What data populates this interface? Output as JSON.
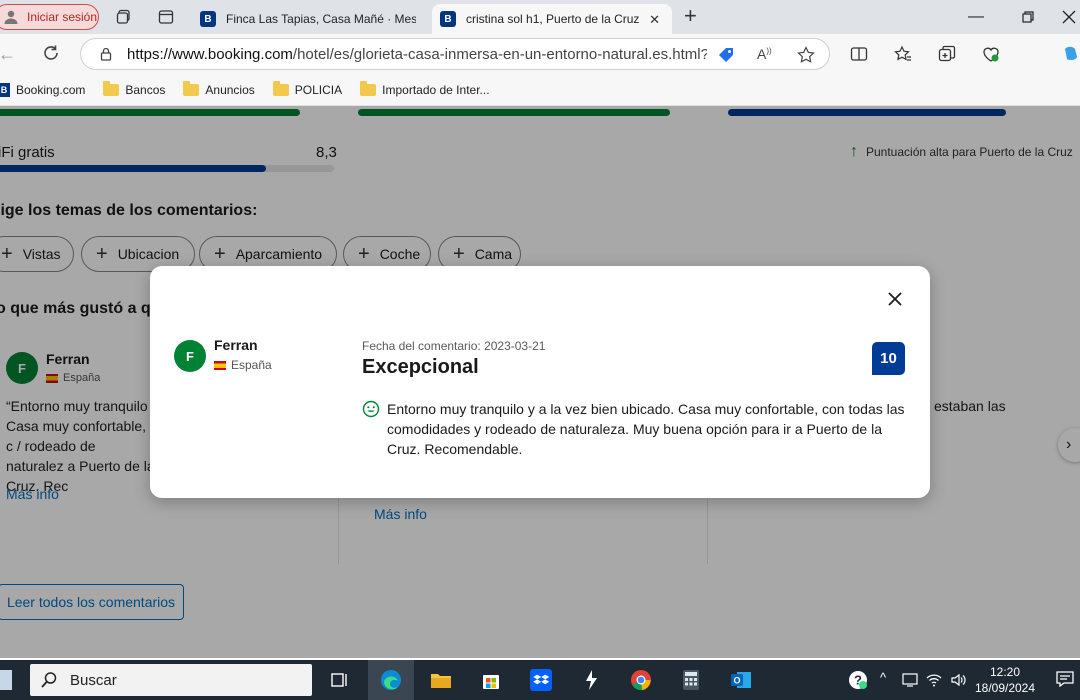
{
  "browser": {
    "profile_label": "Iniciar sesión",
    "tabs": [
      {
        "title": "Finca Las Tapias, Casa Mañé · Mes",
        "favicon": "B",
        "active": false
      },
      {
        "title": "cristina sol h1, Puerto de la Cruz (",
        "favicon": "B",
        "active": true
      }
    ],
    "url_host": "https://www.booking.com",
    "url_path": "/hotel/es/glorieta-casa-inmersa-en-un-entorno-natural.es.html?a...",
    "bookmarks": [
      {
        "label": "Booking.com",
        "type": "site"
      },
      {
        "label": "Bancos",
        "type": "folder"
      },
      {
        "label": "Anuncios",
        "type": "folder"
      },
      {
        "label": "POLICIA",
        "type": "folder"
      },
      {
        "label": "Importado de Inter...",
        "type": "folder"
      }
    ]
  },
  "page": {
    "wifi_label": "iFi gratis",
    "wifi_score": "8,3",
    "score_note": "Puntuación alta para Puerto de la Cruz",
    "topics_title": "lige los temas de los comentarios:",
    "topic_chips": [
      "Vistas",
      "Ubicacion",
      "Aparcamiento",
      "Coche",
      "Cama"
    ],
    "liked_title": "o que más gustó a q",
    "bg_review": {
      "avatar": "F",
      "name": "Ferran",
      "country": "España",
      "text": "“Entorno muy tranquilo Casa muy confortable, c / rodeado de naturalez a Puerto de la Cruz. Rec",
      "more": "Más info"
    },
    "bg_more_2": "Más info",
    "bg_right_text": "estaban las",
    "read_all": "Leer todos los comentarios",
    "colors": {
      "green_bar": "#008234",
      "blue_bar": "#003b95",
      "link": "#0071c2"
    }
  },
  "modal": {
    "avatar": "F",
    "name": "Ferran",
    "country": "España",
    "date_label": "Fecha del comentario: 2023-03-21",
    "title": "Excepcional",
    "score": "10",
    "text": "Entorno muy tranquilo y a la vez bien ubicado. Casa muy confortable, con todas las comodidades y rodeado de naturaleza. Muy buena opción para ir a Puerto de la Cruz. Recomendable."
  },
  "taskbar": {
    "search_placeholder": "Buscar",
    "time": "12:20",
    "date": "18/09/2024",
    "apps": [
      "task-view",
      "edge",
      "file-explorer",
      "store",
      "dropbox",
      "app-s",
      "chrome",
      "calculator",
      "outlook"
    ]
  }
}
